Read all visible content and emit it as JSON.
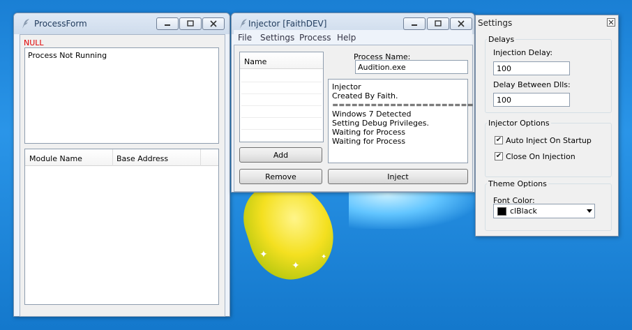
{
  "process_form": {
    "title": "ProcessForm",
    "status": "NULL",
    "status_color": "#e00000",
    "memo_text": "Process Not Running",
    "columns": [
      "Module Name",
      "Base Address"
    ]
  },
  "injector": {
    "title": "Injector [FaithDEV]",
    "menu": [
      "File",
      "Settings",
      "Process",
      "Help"
    ],
    "list_header": "Name",
    "process_name_label": "Process Name:",
    "process_name_value": "Audition.exe",
    "log": [
      "Injector",
      "Created By Faith.",
      "======================",
      "Windows 7 Detected",
      "Setting Debug Privileges.",
      "Waiting for Process",
      "Waiting for Process"
    ],
    "add_label": "Add",
    "remove_label": "Remove",
    "inject_label": "Inject"
  },
  "settings": {
    "title": "Settings",
    "delays_group": "Delays",
    "injection_delay_label": "Injection Delay:",
    "injection_delay_value": "100",
    "between_dlls_label": "Delay Between Dlls:",
    "between_dlls_value": "100",
    "options_group": "Injector Options",
    "auto_inject_label": "Auto Inject On Startup",
    "auto_inject_checked": true,
    "close_on_injection_label": "Close On Injection",
    "close_on_injection_checked": true,
    "theme_group": "Theme Options",
    "font_color_label": "Font Color:",
    "font_color_value": "clBlack",
    "font_color_swatch": "#000000"
  },
  "icons": [
    "app-feather-icon",
    "minimize-icon",
    "maximize-icon",
    "close-icon",
    "dropdown-arrow-icon",
    "checkmark-icon"
  ]
}
